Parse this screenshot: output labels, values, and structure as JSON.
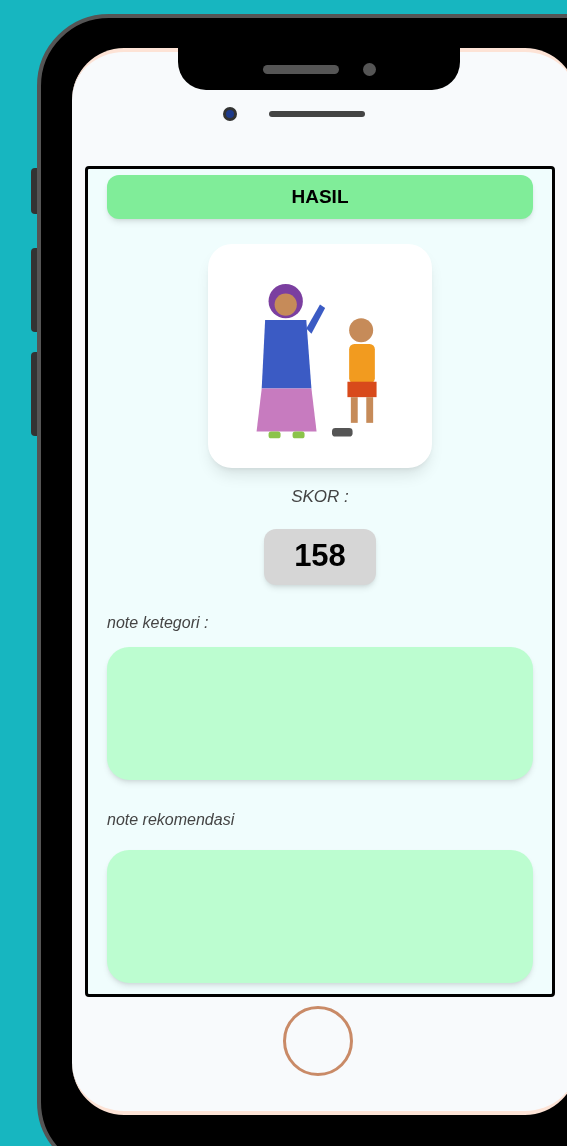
{
  "header": {
    "title": "HASIL"
  },
  "result": {
    "score_label": "SKOR :",
    "score": "158"
  },
  "notes": [
    {
      "label": "note ketegori :"
    },
    {
      "label": "note rekomendasi"
    }
  ]
}
